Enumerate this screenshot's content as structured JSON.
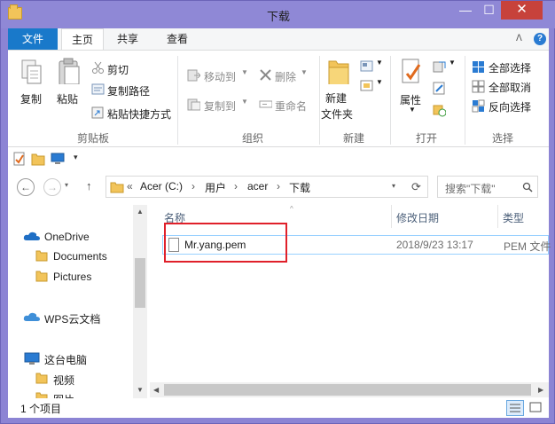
{
  "window": {
    "title": "下载",
    "min_glyph": "—",
    "max_glyph": "☐",
    "close_glyph": "✕"
  },
  "ribbon_tabs": {
    "file": "文件",
    "home": "主页",
    "share": "共享",
    "view": "查看",
    "collapse_glyph": "ᐱ",
    "help_glyph": "?"
  },
  "ribbon": {
    "copy": "复制",
    "paste": "粘贴",
    "cut": "剪切",
    "copy_path": "复制路径",
    "paste_shortcut": "粘贴快捷方式",
    "clipboard_group": "剪贴板",
    "move_to": "移动到",
    "copy_to": "复制到",
    "delete": "删除",
    "rename": "重命名",
    "organize_group": "组织",
    "new_folder_line1": "新建",
    "new_folder_line2": "文件夹",
    "new_group": "新建",
    "properties": "属性",
    "open_group": "打开",
    "select_all": "全部选择",
    "select_none": "全部取消",
    "invert_selection": "反向选择",
    "select_group": "选择"
  },
  "address": {
    "crumbs": [
      "Acer (C:)",
      "用户",
      "acer",
      "下载"
    ],
    "overflow": "«",
    "separator": "›",
    "search_placeholder": "搜索\"下载\""
  },
  "nav": {
    "items": [
      {
        "label": "OneDrive",
        "icon": "cloud-icon"
      },
      {
        "label": "Documents",
        "icon": "folder-icon"
      },
      {
        "label": "Pictures",
        "icon": "folder-icon"
      },
      {
        "label": "WPS云文档",
        "icon": "cloud-icon"
      },
      {
        "label": "这台电脑",
        "icon": "computer-icon"
      },
      {
        "label": "视频",
        "icon": "folder-icon"
      },
      {
        "label": "图片",
        "icon": "folder-icon"
      }
    ]
  },
  "columns": {
    "name": "名称",
    "date": "修改日期",
    "type": "类型"
  },
  "files": [
    {
      "name": "Mr.yang.pem",
      "date": "2018/9/23 13:17",
      "type": "PEM 文件"
    }
  ],
  "status": {
    "count": "1 个项目"
  },
  "colors": {
    "title_bar": "#8f88d6",
    "file_tab": "#1979ca",
    "close_button": "#c7423b",
    "highlight_box": "#e0202a",
    "selection_border": "#99d1ff"
  }
}
